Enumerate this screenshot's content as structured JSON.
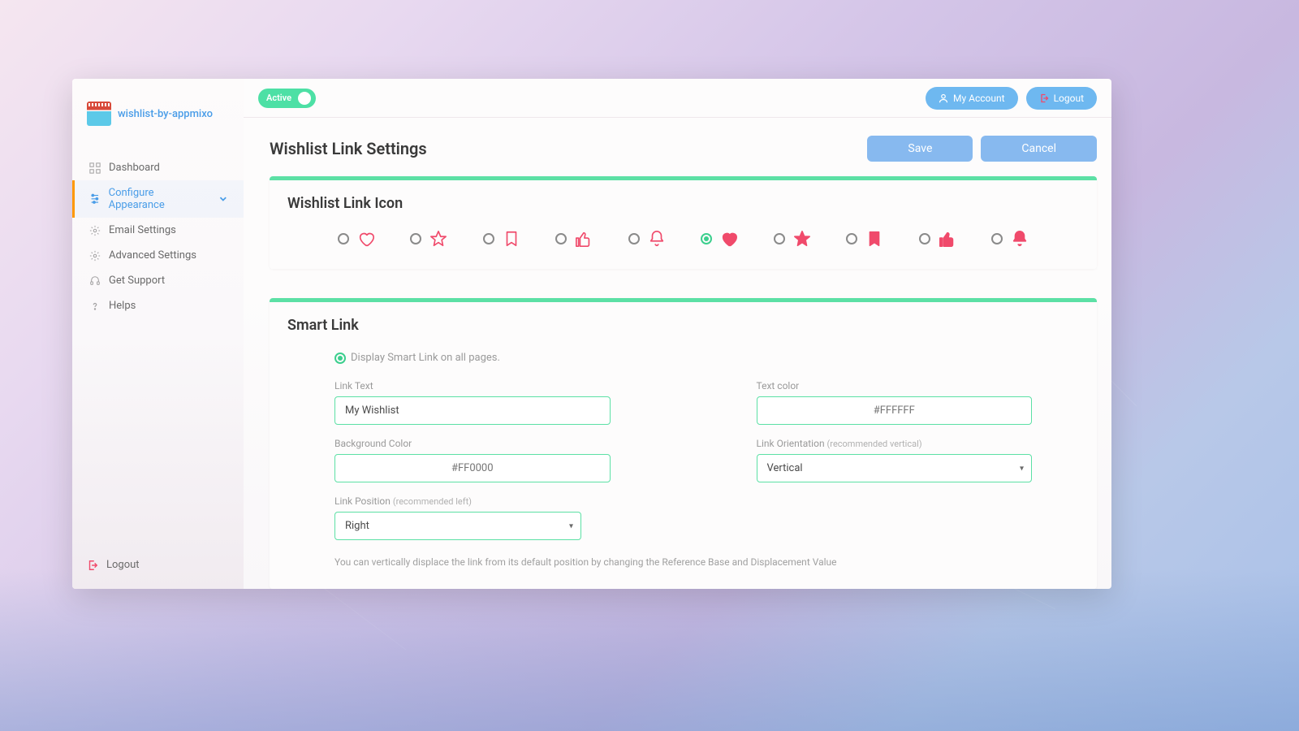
{
  "brand": {
    "name": "wishlist-by-appmixo"
  },
  "sidebar": {
    "items": [
      {
        "label": "Dashboard",
        "icon": "grid"
      },
      {
        "label": "Configure Appearance",
        "icon": "sliders",
        "active": true,
        "expandable": true
      },
      {
        "label": "Email Settings",
        "icon": "gear"
      },
      {
        "label": "Advanced Settings",
        "icon": "gear"
      },
      {
        "label": "Get Support",
        "icon": "headset"
      },
      {
        "label": "Helps",
        "icon": "question"
      }
    ],
    "logout_label": "Logout"
  },
  "topbar": {
    "status_label": "Active",
    "my_account_label": "My Account",
    "logout_label": "Logout"
  },
  "page": {
    "title": "Wishlist Link Settings",
    "save_label": "Save",
    "cancel_label": "Cancel"
  },
  "icon_card": {
    "title": "Wishlist Link Icon",
    "options": [
      {
        "name": "heart-outline",
        "filled": false,
        "type": "heart"
      },
      {
        "name": "star-outline",
        "filled": false,
        "type": "star"
      },
      {
        "name": "bookmark-outline",
        "filled": false,
        "type": "bookmark"
      },
      {
        "name": "thumbsup-outline",
        "filled": false,
        "type": "thumb"
      },
      {
        "name": "bell-outline",
        "filled": false,
        "type": "bell"
      },
      {
        "name": "heart-filled",
        "filled": true,
        "type": "heart",
        "selected": true
      },
      {
        "name": "star-filled",
        "filled": true,
        "type": "star"
      },
      {
        "name": "bookmark-filled",
        "filled": true,
        "type": "bookmark"
      },
      {
        "name": "thumbsup-filled",
        "filled": true,
        "type": "thumb"
      },
      {
        "name": "bell-filled",
        "filled": true,
        "type": "bell"
      }
    ]
  },
  "smart_link": {
    "title": "Smart Link",
    "display_all_pages_label": "Display Smart Link on all pages.",
    "display_all_pages_checked": true,
    "fields": {
      "link_text": {
        "label": "Link Text",
        "value": "My Wishlist"
      },
      "text_color": {
        "label": "Text color",
        "value": "",
        "placeholder": "#FFFFFF"
      },
      "bg_color": {
        "label": "Background Color",
        "value": "",
        "placeholder": "#FF0000"
      },
      "orientation": {
        "label": "Link Orientation ",
        "hint": "(recommended vertical)",
        "value": "Vertical"
      },
      "position": {
        "label": "Link Position ",
        "hint": "(recommended left)",
        "value": "Right"
      }
    },
    "note": "You can vertically displace the link from its default position by changing the Reference Base and Displacement Value"
  }
}
